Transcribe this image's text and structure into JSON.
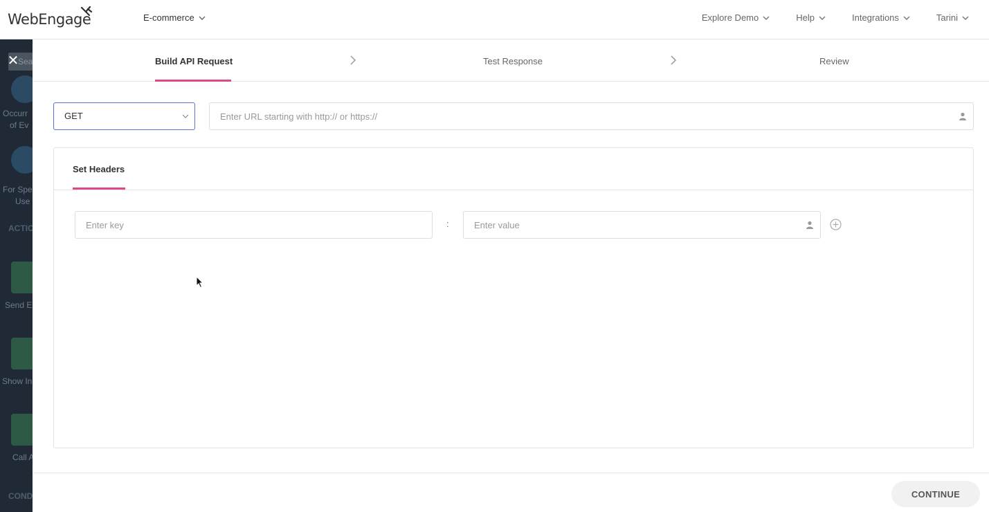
{
  "brand": {
    "name": "WebEngage",
    "accent": "#e0468a",
    "focus": "#5a6fd6"
  },
  "workspace": {
    "label": "E-commerce"
  },
  "topnav": [
    {
      "label": "Explore Demo"
    },
    {
      "label": "Help"
    },
    {
      "label": "Integrations"
    },
    {
      "label": "Tarini"
    }
  ],
  "background_sidebar": {
    "search_text": "Sear",
    "labels": [
      "Occurr",
      "of Ev",
      "For Spe",
      "Use",
      "Send E",
      "Show In",
      "Call A"
    ],
    "headers": [
      "ACTIO",
      "COND"
    ]
  },
  "close_icon": "✕",
  "steps": [
    {
      "label": "Build API Request",
      "active": true
    },
    {
      "label": "Test Response",
      "active": false
    },
    {
      "label": "Review",
      "active": false
    }
  ],
  "request": {
    "method": "GET",
    "url_placeholder": "Enter URL starting with http:// or https://"
  },
  "headers_section": {
    "tab_label": "Set Headers",
    "key_placeholder": "Enter key",
    "separator": ":",
    "value_placeholder": "Enter value"
  },
  "footer": {
    "continue_label": "CONTINUE"
  }
}
